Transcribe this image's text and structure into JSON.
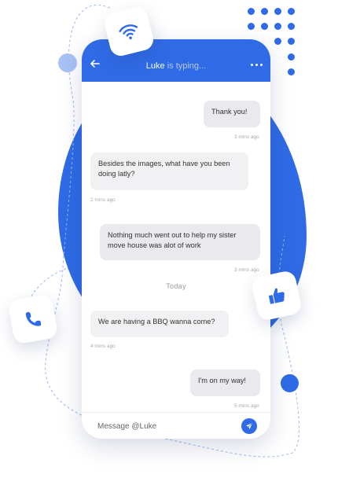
{
  "header": {
    "contact_name": "Luke",
    "status_text": "is typing..."
  },
  "messages": [
    {
      "text": "Thank you!",
      "direction": "outgoing",
      "time": "3 mins ago"
    },
    {
      "text": "Besides the images, what have you been doing latly?",
      "direction": "incoming",
      "time": "2 mins ago"
    },
    {
      "text": "Nothing much went out to help my sister move house was alot of work",
      "direction": "outgoing",
      "time": "3 mins ago"
    },
    {
      "text": "We are having a BBQ wanna come?",
      "direction": "incoming",
      "time": "4 mins ago"
    },
    {
      "text": "I'm on my way!",
      "direction": "outgoing",
      "time": "5 mins ago"
    }
  ],
  "divider_label": "Today",
  "composer": {
    "placeholder": "Message @Luke"
  },
  "icons": {
    "back": "arrow-left-icon",
    "more": "more-dots-icon",
    "send": "send-icon",
    "wifi": "wifi-icon",
    "phone": "phone-icon",
    "like": "thumbs-up-icon"
  },
  "colors": {
    "accent": "#2f6be6",
    "bubble": "#f1f1f3",
    "light_circle": "#a9c1f6"
  }
}
